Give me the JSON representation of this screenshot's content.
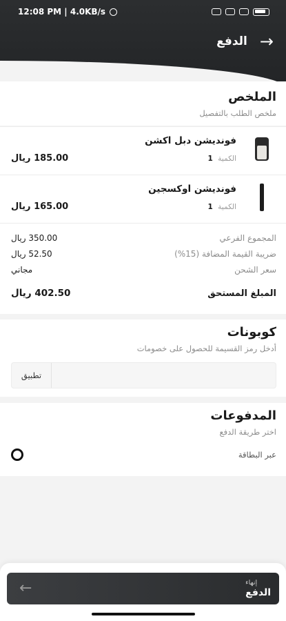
{
  "status_bar": {
    "time_info": "12:08 PM | 4.0KB/s",
    "battery": "89"
  },
  "header": {
    "title": "الدفع",
    "back_icon": "arrow-right-icon"
  },
  "summary": {
    "title": "الملخص",
    "subtitle": "ملخص الطلب بالتفصيل",
    "items": [
      {
        "name": "فونديشن دبل اكشن",
        "qty_label": "الكمية",
        "qty": "1",
        "price": "185.00 ريال"
      },
      {
        "name": "فونديشن اوكسجين",
        "qty_label": "الكمية",
        "qty": "1",
        "price": "165.00 ريال"
      }
    ],
    "totals": {
      "subtotal_label": "المجموع الفرعي",
      "subtotal_value": "350.00 ريال",
      "vat_label": "ضريبة القيمة المضافة (15%)",
      "vat_value": "52.50 ريال",
      "shipping_label": "سعر الشحن",
      "shipping_value": "مجاني",
      "due_label": "المبلغ المستحق",
      "due_value": "402.50 ريال"
    }
  },
  "coupons": {
    "title": "كوبونات",
    "subtitle": "أدخل رمز القسيمة للحصول على خصومات",
    "input_value": "",
    "apply_label": "تطبيق"
  },
  "payments": {
    "title": "المدفوعات",
    "subtitle": "اختر طريقة الدفع",
    "option_label": "عبر البطاقة"
  },
  "footer": {
    "small_label": "إنهاء",
    "main_label": "الدفع"
  },
  "colors": {
    "header_bg": "#2c2e30",
    "button_bg": "#35373a",
    "muted_text": "#8c8c8c"
  }
}
